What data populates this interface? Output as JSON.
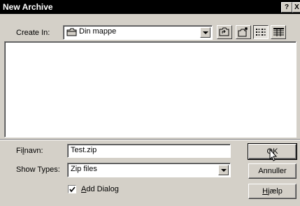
{
  "window": {
    "title": "New Archive",
    "help_button": "?",
    "close_button": "X"
  },
  "create_in": {
    "label": "Create In:",
    "value": "Din mappe"
  },
  "toolbar": {
    "icons": [
      "up-folder-icon",
      "new-folder-icon",
      "list-view-icon",
      "details-view-icon"
    ]
  },
  "filename": {
    "label_pre": "Fi",
    "label_accel": "l",
    "label_post": "navn:",
    "value": "Test.zip"
  },
  "show_types": {
    "label": "Show Types:",
    "value": "Zip files"
  },
  "add_dialog": {
    "checked": true,
    "label_accel": "A",
    "label_post": "dd Dialog"
  },
  "buttons": {
    "ok": "OK",
    "cancel": "Annuller",
    "help_accel": "H",
    "help_post": "jælp"
  }
}
